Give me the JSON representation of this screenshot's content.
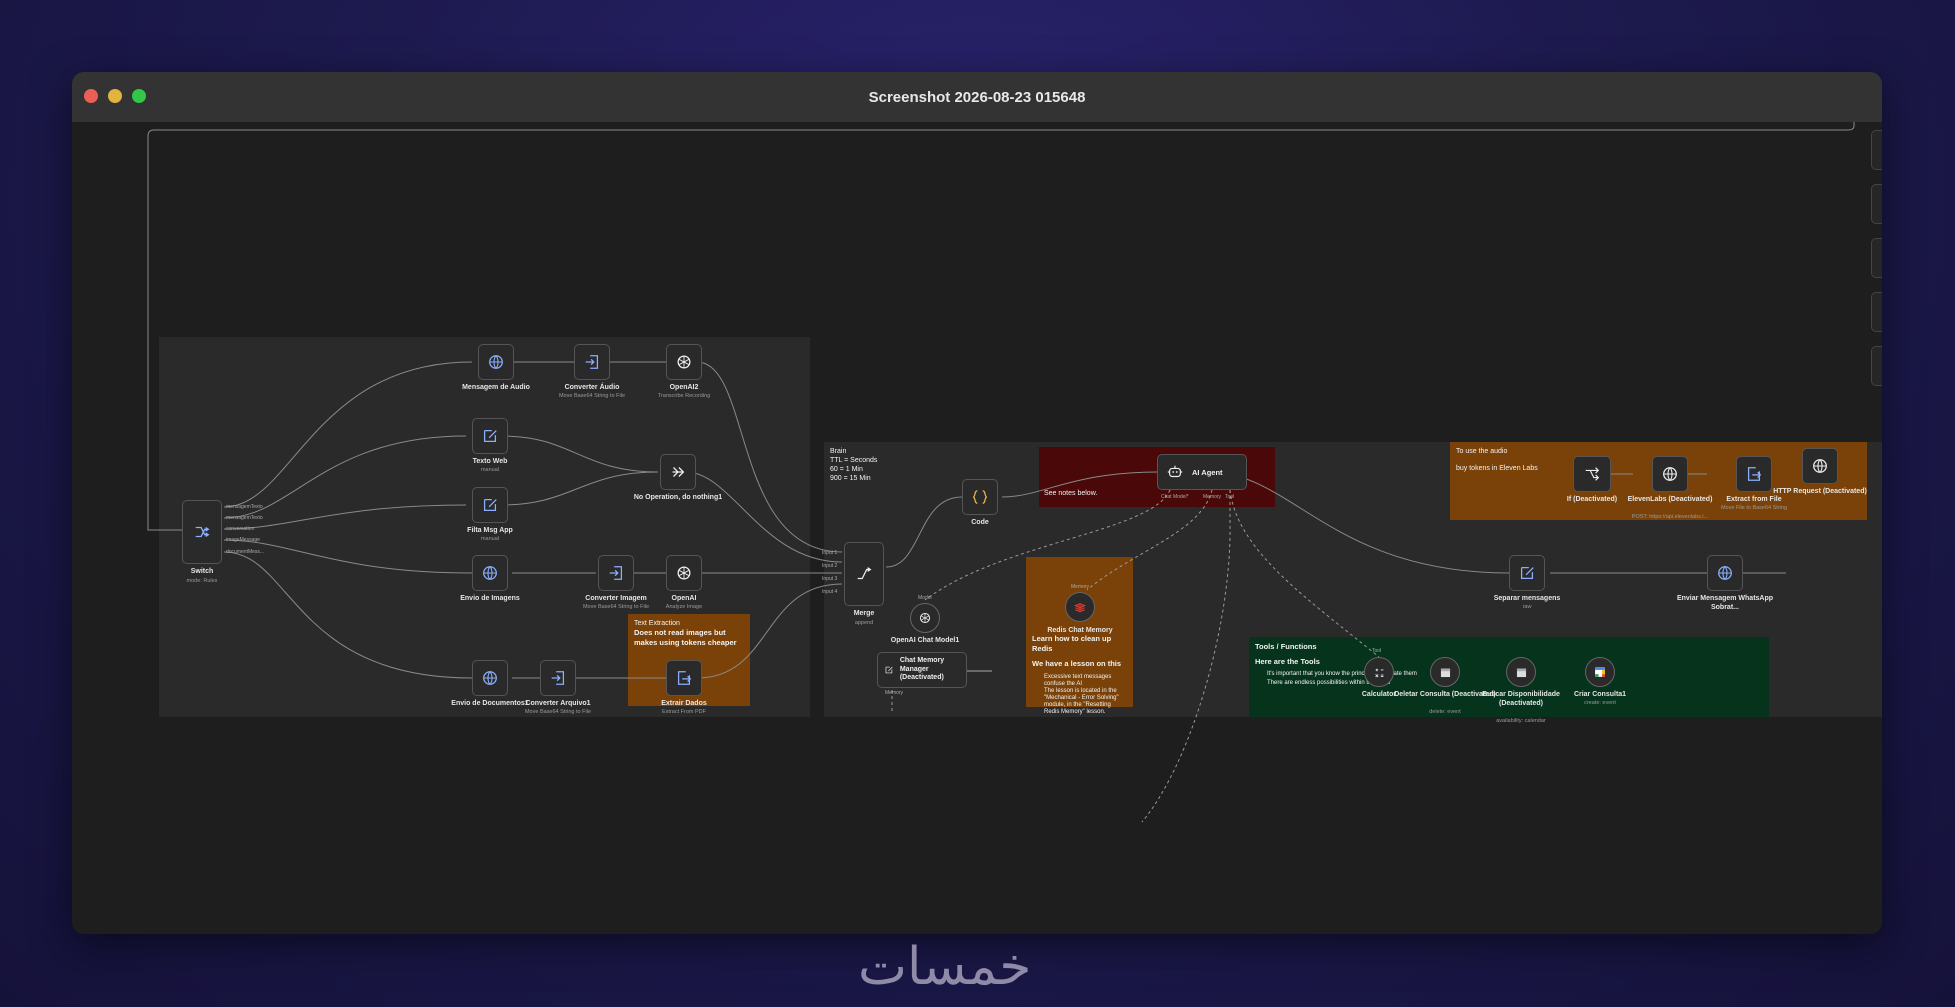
{
  "window": {
    "title": "Screenshot 2026-08-23 015648"
  },
  "colors": {
    "close": "#ec5f57",
    "minimize": "#e1b33f",
    "maximize": "#33c748",
    "note_orange": "#7a4208",
    "note_red": "#4a0808",
    "note_green": "#06331c",
    "note_gray": "#2a2a2a"
  },
  "notes": {
    "brain": {
      "title": "Brain",
      "lines": [
        "TTL = Seconds",
        "60 = 1 Min",
        "900 = 15 Min"
      ]
    },
    "see_notes": "See notes below.",
    "text_extraction": {
      "title": "Text Extraction",
      "body": "Does not read images but makes using tokens cheaper"
    },
    "eleven": {
      "line1": "To use the audio",
      "line2": "buy tokens in Eleven Labs"
    },
    "redis": {
      "title": "Learn how to clean up Redis",
      "line2": "We have a lesson on this",
      "bullet1": "Excessive text messages confuse the AI",
      "bullet2": "The lesson is located in the \"Mechanical - Error Solving\" module, in the \"Resetting Redis Memory\" lesson."
    },
    "tools": {
      "title": "Tools / Functions",
      "sub": "Here are the Tools",
      "line1": "It's important that you know the principles to create them",
      "line2": "There are endless possibilities within the Tools"
    }
  },
  "nodes": {
    "switch": {
      "label": "Switch",
      "sub": "mode: Rules",
      "outputs": [
        "mensagemTexto",
        "mensagemTexto",
        "conversation",
        "imageMessage",
        "documentMess..."
      ]
    },
    "msg_audio": {
      "label": "Mensagem de Audio",
      "sub": ""
    },
    "conv_audio": {
      "label": "Converter Áudio",
      "sub": "Move Base64 String to File"
    },
    "openai2": {
      "label": "OpenAI2",
      "sub": "Transcribe Recording"
    },
    "texto_web": {
      "label": "Texto Web",
      "sub": "manual"
    },
    "noop": {
      "label": "No Operation, do nothing1",
      "sub": ""
    },
    "filtra": {
      "label": "Filta Msg App",
      "sub": "manual"
    },
    "envio_img": {
      "label": "Envio de Imagens",
      "sub": ""
    },
    "conv_img": {
      "label": "Converter Imagem",
      "sub": "Move Base64 String to File"
    },
    "openai": {
      "label": "OpenAI",
      "sub": "Analyze Image"
    },
    "envio_doc": {
      "label": "Envio de Documentos1",
      "sub": ""
    },
    "conv_arq": {
      "label": "Converter Arquivo1",
      "sub": "Move Base64 String to File"
    },
    "extrair": {
      "label": "Extrair Dados",
      "sub": "Extract From PDF"
    },
    "merge": {
      "label": "Merge",
      "sub": "append",
      "inputs": [
        "Input 1",
        "Input 2",
        "Input 3",
        "Input 4"
      ]
    },
    "code": {
      "label": "Code",
      "sub": ""
    },
    "ai_agent": {
      "label": "AI Agent",
      "ports": [
        "Chat Model*",
        "Memory",
        "Tool"
      ]
    },
    "chat_model": {
      "label": "OpenAI Chat Model1",
      "port": "Model"
    },
    "redis_mem": {
      "label": "Redis Chat Memory",
      "port": "Memory"
    },
    "mem_manager": {
      "label": "Chat Memory Manager (Deactivated)",
      "port": "Memory"
    },
    "if": {
      "label": "If (Deactivated)"
    },
    "eleven": {
      "label": "ElevenLabs (Deactivated)",
      "sub": "POST: https://api.elevenlabs.i..."
    },
    "extract_file": {
      "label": "Extract from File",
      "sub": "Move File to Base64 String"
    },
    "http": {
      "label": "HTTP Request (Deactivated)"
    },
    "separar": {
      "label": "Separar mensagens",
      "sub": "raw"
    },
    "enviar": {
      "label": "Enviar Mensagem WhatsApp Sobrat..."
    },
    "calculator": {
      "label": "Calculator",
      "port": "Tool"
    },
    "deletar": {
      "label": "Deletar Consulta (Deactivated)",
      "sub": "delete: event"
    },
    "buscar": {
      "label": "Buscar Disponibilidade (Deactivated)",
      "sub": "availability: calendar"
    },
    "criar": {
      "label": "Criar Consulta1",
      "sub": "create: event"
    }
  },
  "watermark": "خمسات"
}
